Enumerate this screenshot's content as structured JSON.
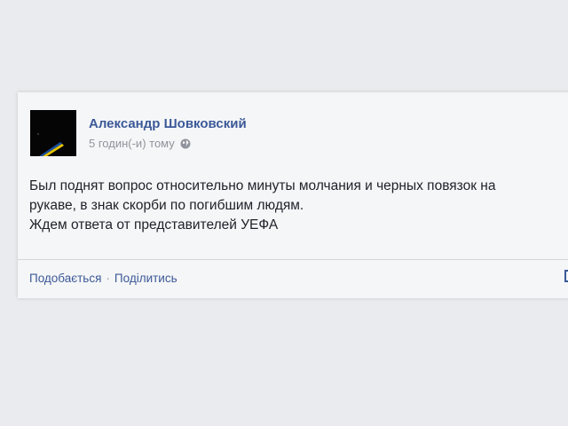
{
  "post": {
    "author": "Александр Шовковский",
    "timestamp": "5 годин(-и) тому",
    "privacy_icon": "globe-icon",
    "text_lines": [
      "Был поднят вопрос относительно минуты молчания и черных повязок на",
      "рукаве, в знак скорби по погибшим людям.",
      "Ждем ответа от представителей УЕФА"
    ]
  },
  "actions": {
    "like": "Подобається",
    "separator": "·",
    "share": "Поділитись"
  },
  "colors": {
    "link": "#3b5998",
    "meta": "#90949c",
    "text": "#1d2129",
    "background": "#e9ebee"
  }
}
